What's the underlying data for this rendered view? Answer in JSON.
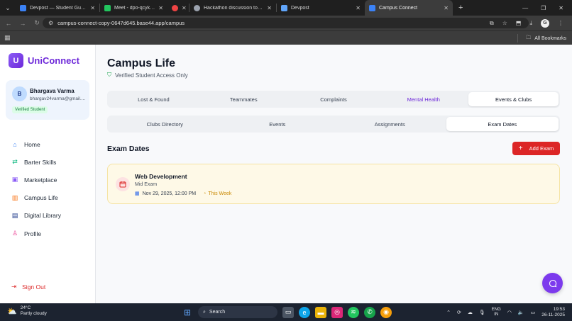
{
  "browser": {
    "tabs": [
      {
        "title": "Devpost — Student Guide for E",
        "color": "#3b82f6"
      },
      {
        "title": "Meet - dpo-qcyk-fah",
        "color": "#22c55e"
      },
      {
        "title": "",
        "color": "#ef4444"
      },
      {
        "title": "Hackathon discussion topics",
        "color": "#9ca3af"
      },
      {
        "title": "Devpost",
        "color": "#60a5fa"
      },
      {
        "title": "Campus Connect",
        "color": "#3b82f6"
      }
    ],
    "url": "campus-connect-copy-0647d645.base44.app/campus",
    "all_bookmarks": "All Bookmarks"
  },
  "sidebar": {
    "brand": "UniConnect",
    "brand_letter": "U",
    "user": {
      "initial": "B",
      "name": "Bhargava Varma",
      "email": "bhargav24varma@gmail....",
      "badge": "Verified Student"
    },
    "nav": [
      {
        "label": "Home",
        "icon": "home-icon",
        "color": "#3b82f6"
      },
      {
        "label": "Barter Skills",
        "icon": "swap-icon",
        "color": "#10b981"
      },
      {
        "label": "Marketplace",
        "icon": "shopping-bag-icon",
        "color": "#8b5cf6"
      },
      {
        "label": "Campus Life",
        "icon": "building-icon",
        "color": "#f97316"
      },
      {
        "label": "Digital Library",
        "icon": "book-icon",
        "color": "#1e3a8a"
      },
      {
        "label": "Profile",
        "icon": "user-icon",
        "color": "#ec4899"
      }
    ],
    "sign_out": "Sign Out"
  },
  "main": {
    "title": "Campus Life",
    "subtitle": "Verified Student Access Only",
    "tabs_primary": [
      {
        "label": "Lost & Found"
      },
      {
        "label": "Teammates"
      },
      {
        "label": "Complaints"
      },
      {
        "label": "Mental Health"
      },
      {
        "label": "Events & Clubs"
      }
    ],
    "tabs_secondary": [
      {
        "label": "Clubs Directory"
      },
      {
        "label": "Events"
      },
      {
        "label": "Assignments"
      },
      {
        "label": "Exam Dates"
      }
    ],
    "section_title": "Exam Dates",
    "add_button": "Add Exam",
    "exams": [
      {
        "name": "Web Development",
        "type": "Mid Exam",
        "datetime": "Nov 29, 2025, 12:00 PM",
        "tag": "This Week"
      }
    ]
  },
  "taskbar": {
    "weather_temp": "24°C",
    "weather_desc": "Partly cloudy",
    "search": "Search",
    "lang_top": "ENG",
    "lang_bottom": "IN",
    "time": "19:53",
    "date": "26-11-2025"
  },
  "colors": {
    "accent": "#6d28d9",
    "danger": "#dc2626",
    "success": "#16a34a"
  }
}
